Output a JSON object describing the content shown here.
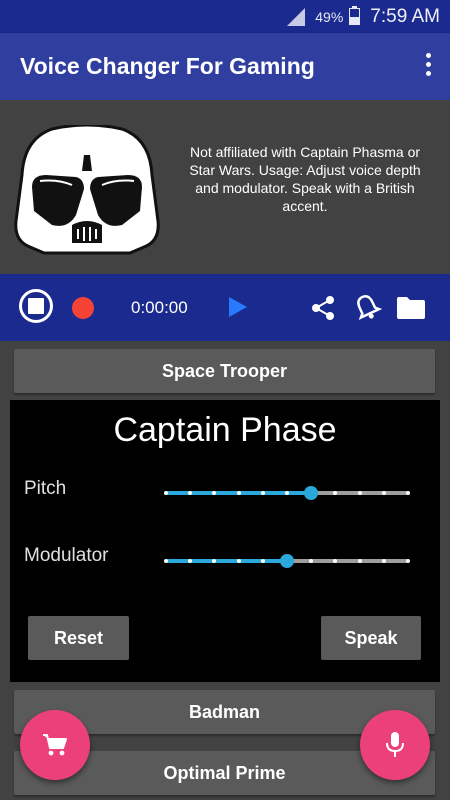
{
  "status_bar": {
    "battery": "49%",
    "time": "7:59 AM"
  },
  "app_bar": {
    "title": "Voice Changer For Gaming"
  },
  "header": {
    "disclaimer": "Not affiliated with Captain Phasma or Star Wars.  Usage: Adjust voice depth and modulator. Speak with a British accent."
  },
  "player": {
    "time": "0:00:00",
    "accent": "#2979ff",
    "record_color": "#f44336"
  },
  "voices": {
    "top": "Space Trooper",
    "bottom_1": "Badman",
    "bottom_2": "Optimal Prime"
  },
  "panel": {
    "title": "Captain Phase",
    "pitch": {
      "label": "Pitch",
      "value": 0.6,
      "ticks": 11
    },
    "modulator": {
      "label": "Modulator",
      "value": 0.5,
      "ticks": 11
    },
    "reset_label": "Reset",
    "speak_label": "Speak"
  },
  "fabs": {
    "cart_icon": "shopping-cart-icon",
    "mic_icon": "microphone-icon",
    "color": "#ec407a"
  }
}
